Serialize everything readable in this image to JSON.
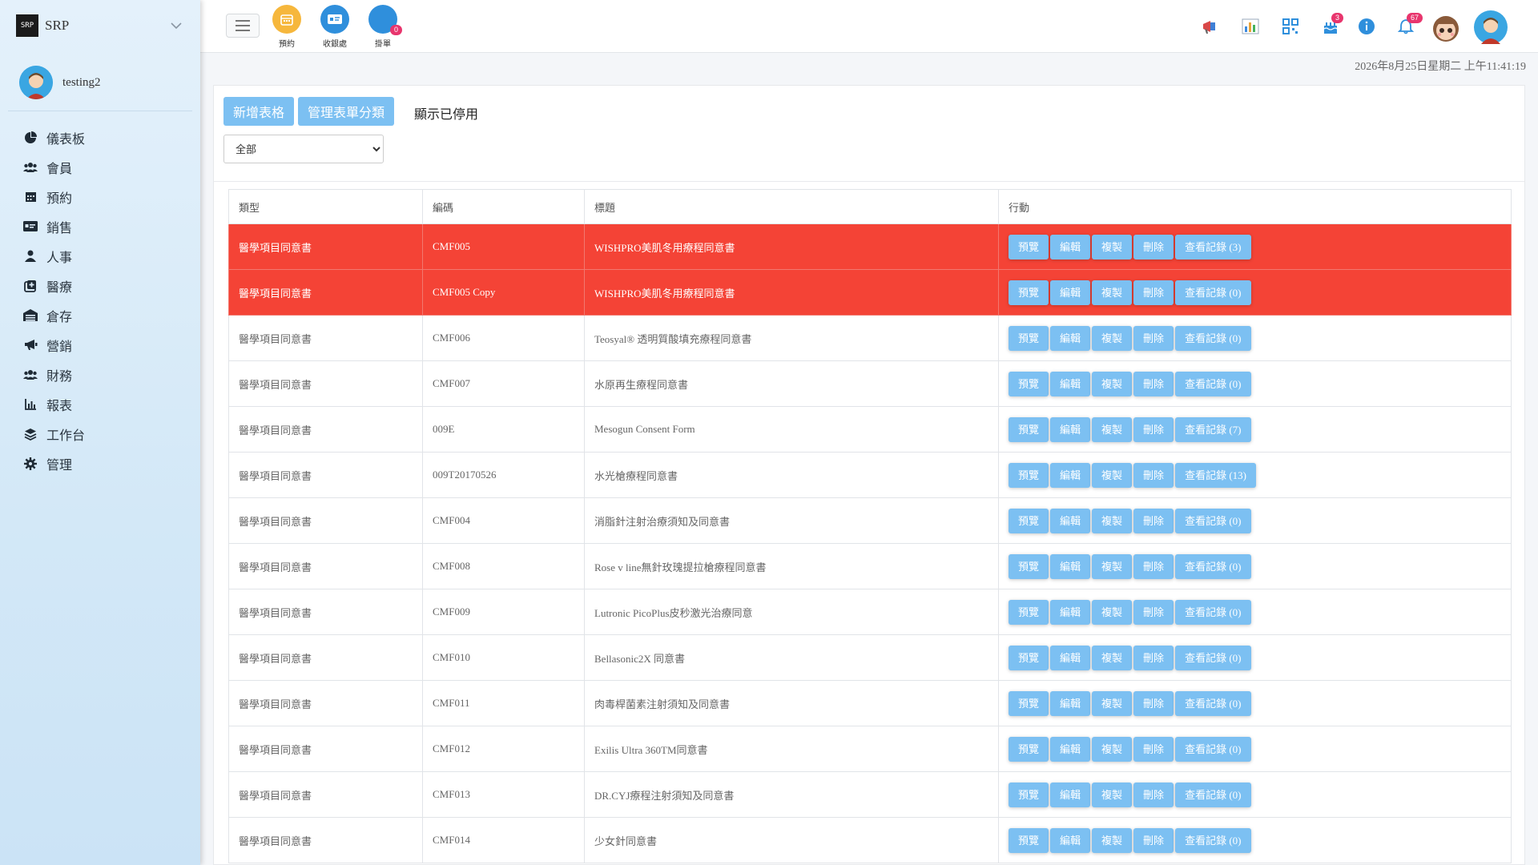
{
  "brand": {
    "name": "SRP",
    "logo_text": "SRP"
  },
  "user": {
    "name": "testing2"
  },
  "sidebar": {
    "items": [
      {
        "label": "儀表板",
        "icon": "pie-chart-icon"
      },
      {
        "label": "會員",
        "icon": "users-icon"
      },
      {
        "label": "預約",
        "icon": "calendar-icon"
      },
      {
        "label": "銷售",
        "icon": "id-card-icon"
      },
      {
        "label": "人事",
        "icon": "user-icon"
      },
      {
        "label": "醫療",
        "icon": "medical-icon"
      },
      {
        "label": "倉存",
        "icon": "warehouse-icon"
      },
      {
        "label": "營銷",
        "icon": "megaphone-icon"
      },
      {
        "label": "財務",
        "icon": "users-icon"
      },
      {
        "label": "報表",
        "icon": "bar-chart-icon"
      },
      {
        "label": "工作台",
        "icon": "layers-icon"
      },
      {
        "label": "管理",
        "icon": "gear-icon"
      }
    ]
  },
  "header": {
    "quick": [
      {
        "label": "預約",
        "color": "#f6b73c"
      },
      {
        "label": "收銀處",
        "color": "#2f8fdc"
      },
      {
        "label": "掛單",
        "color": "#2f8fdc",
        "badge": "0"
      }
    ],
    "badges": {
      "cake": "3",
      "bell": "67"
    }
  },
  "datetime": "2026年8月25日星期二 上午11:41:19",
  "toolbar": {
    "add_label": "新增表格",
    "manage_label": "管理表單分類",
    "show_disabled": "顯示已停用",
    "filter_value": "全部"
  },
  "table": {
    "headers": [
      "類型",
      "編碼",
      "標題",
      "行動"
    ],
    "actions": [
      "預覽",
      "編輯",
      "複製",
      "刪除"
    ],
    "log_label": "查看記錄",
    "rows": [
      {
        "type": "醫學項目同意書",
        "code": "CMF005",
        "title": "WISHPRO美肌冬用療程同意書",
        "logs": "(3)",
        "danger": true
      },
      {
        "type": "醫學項目同意書",
        "code": "CMF005 Copy",
        "title": "WISHPRO美肌冬用療程同意書",
        "logs": "(0)",
        "danger": true
      },
      {
        "type": "醫學項目同意書",
        "code": "CMF006",
        "title": "Teosyal® 透明質酸填充療程同意書",
        "logs": "(0)"
      },
      {
        "type": "醫學項目同意書",
        "code": "CMF007",
        "title": "水原再生療程同意書",
        "logs": "(0)"
      },
      {
        "type": "醫學項目同意書",
        "code": "009E",
        "title": "Mesogun Consent Form",
        "logs": "(7)"
      },
      {
        "type": "醫學項目同意書",
        "code": "009T20170526",
        "title": "水光槍療程同意書",
        "logs": "(13)"
      },
      {
        "type": "醫學項目同意書",
        "code": "CMF004",
        "title": "消脂針注射治療須知及同意書",
        "logs": "(0)"
      },
      {
        "type": "醫學項目同意書",
        "code": "CMF008",
        "title": "Rose v line無針玫瑰提拉槍療程同意書",
        "logs": "(0)"
      },
      {
        "type": "醫學項目同意書",
        "code": "CMF009",
        "title": "Lutronic PicoPlus皮秒激光治療同意",
        "logs": "(0)"
      },
      {
        "type": "醫學項目同意書",
        "code": "CMF010",
        "title": "Bellasonic2X 同意書",
        "logs": "(0)"
      },
      {
        "type": "醫學項目同意書",
        "code": "CMF011",
        "title": "肉毒桿菌素注射須知及同意書",
        "logs": "(0)"
      },
      {
        "type": "醫學項目同意書",
        "code": "CMF012",
        "title": "Exilis Ultra 360TM同意書",
        "logs": "(0)"
      },
      {
        "type": "醫學項目同意書",
        "code": "CMF013",
        "title": "DR.CYJ療程注射須知及同意書",
        "logs": "(0)"
      },
      {
        "type": "醫學項目同意書",
        "code": "CMF014",
        "title": "少女針同意書",
        "logs": "(0)"
      }
    ]
  }
}
